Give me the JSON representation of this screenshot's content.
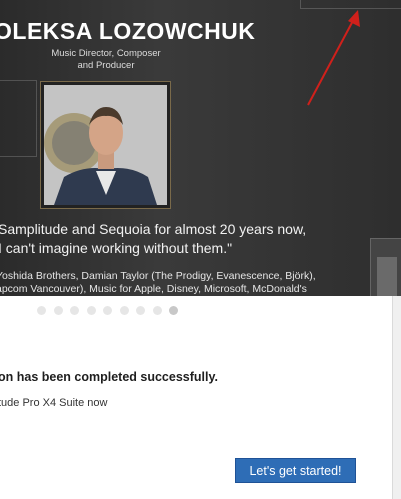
{
  "banner": {
    "artist_name": "OLEKSA LOZOWCHUK",
    "role_line1": "Music Director, Composer",
    "role_line2": "and Producer",
    "quote_line1": "Samplitude and Sequoia for almost 20 years now,",
    "quote_line2": "I can't imagine working without them.\"",
    "credits_line1": "Yoshida Brothers, Damian Taylor (The Prodigy, Evanescence, Björk),",
    "credits_line2": "apcom Vancouver), Music for Apple, Disney, Microsoft, McDonald's"
  },
  "carousel": {
    "dot_count": 9,
    "active_index": 8
  },
  "message": {
    "status": "on has been completed successfully.",
    "product": "tude Pro X4 Suite now"
  },
  "actions": {
    "start_label": "Let's get started!"
  },
  "colors": {
    "accent": "#2e6db6",
    "arrow": "#d0201b",
    "banner_bg": "#333333"
  }
}
